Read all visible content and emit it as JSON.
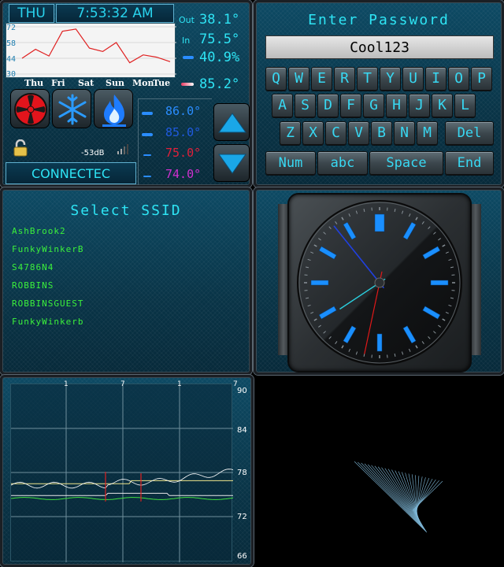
{
  "weather": {
    "day": "THU",
    "time": "7:53:32 AM",
    "y_labels": [
      "72",
      "58",
      "44",
      "30"
    ],
    "days": [
      "Thu",
      "Fri",
      "Sat",
      "Sun",
      "Mon",
      "Tue"
    ],
    "forecast": [
      44,
      52,
      46,
      68,
      70,
      53,
      50,
      58,
      40,
      47,
      45,
      41
    ],
    "out_label": "Out",
    "out_temp": "38.1°",
    "in_label": "In",
    "in_temp": "75.5°",
    "humidity": "40.9%",
    "aux_temp": "85.2°",
    "signal": "-53dB",
    "status": "CONNECTEC",
    "icons": [
      "fan-icon",
      "snowflake-icon",
      "flame-icon",
      "lock-icon",
      "signal-bars-icon"
    ]
  },
  "thermostat": {
    "setpoints": [
      "86.0°",
      "85.0°",
      "75.0°",
      "74.0°"
    ],
    "colors": [
      "#2a8dff",
      "#2a8dff",
      "#e0203a",
      "#d030d0"
    ]
  },
  "keyboard": {
    "title": "Enter Password",
    "value": "Cool123",
    "row1": [
      "Q",
      "W",
      "E",
      "R",
      "T",
      "Y",
      "U",
      "I",
      "O",
      "P"
    ],
    "row2": [
      "A",
      "S",
      "D",
      "F",
      "G",
      "H",
      "J",
      "K",
      "L"
    ],
    "row3": [
      "Z",
      "X",
      "C",
      "V",
      "B",
      "N",
      "M"
    ],
    "del": "Del",
    "num": "Num",
    "abc": "abc",
    "space": "Space",
    "end": "End"
  },
  "ssid": {
    "title": "Select SSID",
    "networks": [
      "AshBrook2",
      "FunkyWinkerB",
      "S4786N4",
      "ROBBINS",
      "ROBBINSGUEST",
      "FunkyWinkerb"
    ]
  },
  "clock": {
    "hours": 7,
    "minutes": 53,
    "seconds": 32
  },
  "history": {
    "x_labels": [
      "1",
      "7",
      "1",
      "7"
    ],
    "y_labels": [
      "90",
      "84",
      "78",
      "72",
      "66"
    ]
  },
  "colors": {
    "accent": "#2ee4f4",
    "ssid_green": "#3bf03b"
  }
}
